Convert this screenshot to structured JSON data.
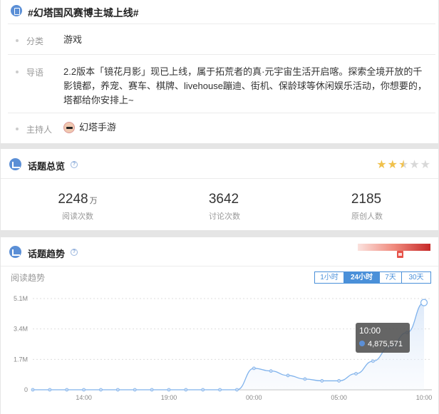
{
  "topic": {
    "title": "#幻塔国风赛博主城上线#",
    "category_label": "分类",
    "category_value": "游戏",
    "intro_label": "导语",
    "intro_text": "2.2版本「镜花月影」现已上线，属于拓荒者的真·元宇宙生活开启喀。探索全境开放的千影镜都，养宠、赛车、棋牌、livehouse蹦迪、街机、保龄球等休闲娱乐活动，你想要的，塔都给你安排上~",
    "host_label": "主持人",
    "host_name": "幻塔手游"
  },
  "overview": {
    "title": "话题总览",
    "help": "?",
    "rating": 2.5,
    "stats": [
      {
        "value": "2248",
        "unit": "万",
        "label": "阅读次数"
      },
      {
        "value": "3642",
        "unit": "",
        "label": "讨论次数"
      },
      {
        "value": "2185",
        "unit": "",
        "label": "原创人数"
      }
    ]
  },
  "trend": {
    "title": "话题趋势",
    "help": "?",
    "sublabel": "阅读趋势",
    "heat_level": 0.58,
    "range_tabs": [
      {
        "label": "1小时",
        "active": false
      },
      {
        "label": "24小时",
        "active": true
      },
      {
        "label": "7天",
        "active": false
      },
      {
        "label": "30天",
        "active": false
      }
    ],
    "tooltip": {
      "time": "10:00",
      "value": "4,875,571"
    },
    "colors": {
      "accent": "#4a90d9",
      "line": "#7fb2ec"
    }
  },
  "chart_data": {
    "type": "area",
    "ylim": [
      0,
      5100000
    ],
    "y_ticks": [
      {
        "value": 0,
        "label": "0"
      },
      {
        "value": 1700000,
        "label": "1.7M"
      },
      {
        "value": 3400000,
        "label": "3.4M"
      },
      {
        "value": 5100000,
        "label": "5.1M"
      }
    ],
    "x_ticks": [
      {
        "index": 3,
        "label": "14:00"
      },
      {
        "index": 8,
        "label": "19:00"
      },
      {
        "index": 13,
        "label": "00:00"
      },
      {
        "index": 18,
        "label": "05:00"
      },
      {
        "index": 23,
        "label": "10:00"
      }
    ],
    "series": [
      {
        "values": [
          0,
          0,
          0,
          0,
          0,
          0,
          0,
          0,
          0,
          0,
          0,
          0,
          0,
          1200000,
          1050000,
          800000,
          600000,
          500000,
          500000,
          900000,
          1600000,
          2400000,
          3200000,
          4875571
        ]
      }
    ]
  }
}
